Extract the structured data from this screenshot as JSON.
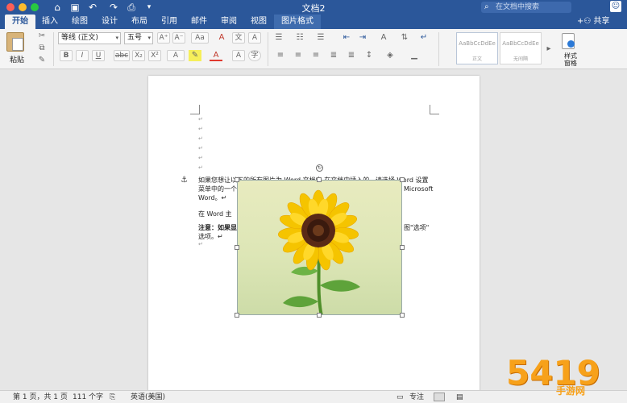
{
  "window": {
    "title": "文档2",
    "search_placeholder": "在文档中搜索"
  },
  "tabs": [
    {
      "label": "开始",
      "active": true
    },
    {
      "label": "插入"
    },
    {
      "label": "绘图"
    },
    {
      "label": "设计"
    },
    {
      "label": "布局"
    },
    {
      "label": "引用"
    },
    {
      "label": "邮件"
    },
    {
      "label": "审阅"
    },
    {
      "label": "视图"
    },
    {
      "label": "图片格式"
    }
  ],
  "share_label": "共享",
  "ribbon": {
    "paste_label": "粘贴",
    "font_name": "等线 (正文)",
    "font_size": "五号",
    "format_buttons": [
      "B",
      "I",
      "U",
      "abc",
      "X₂",
      "X²"
    ],
    "styles": [
      {
        "preview": "AaBbCcDdEe",
        "name": "正文"
      },
      {
        "preview": "AaBbCcDdEe",
        "name": "无间隔"
      }
    ],
    "styles_pane_label": "样式窗格"
  },
  "document": {
    "para_mark": "↵",
    "lines": [
      "如果您想让以下的所有图片为 Word 文档中 在文档中插入的...请选择 Word 设置",
      "菜单中的一个",
      "Word。↵",
      "在 Word 主",
      "注意：如果显",
      "选项。↵"
    ],
    "right_fragments": [
      "Microsoft",
      "图\"选项\""
    ],
    "bold_label": "注意："
  },
  "status": {
    "page": "第 1 页，共 1 页",
    "words": "111 个字",
    "language": "英语(美国)",
    "focus": "专注"
  },
  "watermark": {
    "text": "5419",
    "sub": "手游网"
  },
  "colors": {
    "accent": "#2b579a",
    "watermark": "#f7a11a"
  }
}
